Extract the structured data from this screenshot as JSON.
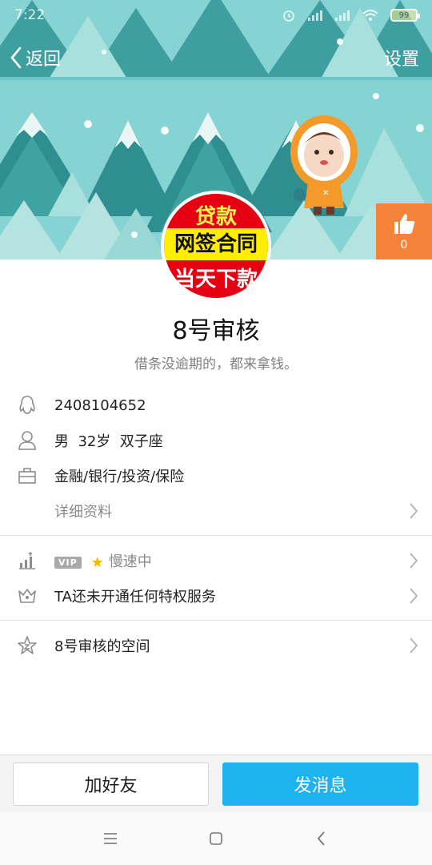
{
  "status_bar": {
    "time": "7:22",
    "battery": "99"
  },
  "nav": {
    "back_label": "返回",
    "settings_label": "设置"
  },
  "like": {
    "count": "0"
  },
  "avatar": {
    "line1": "贷款",
    "line2": "网签合同",
    "line3": "当天下款"
  },
  "profile": {
    "name": "8号审核",
    "signature": "借条没逾期的，都来拿钱。",
    "qq": "2408104652",
    "gender": "男",
    "age": "32岁",
    "zodiac": "双子座",
    "occupation": "金融/银行/投资/保险",
    "details_link": "详细资料"
  },
  "privileges": {
    "vip_badge": "VIP",
    "speed_text": "慢速中",
    "service_text": "TA还未开通任何特权服务"
  },
  "space": {
    "label": "8号审核的空间"
  },
  "buttons": {
    "add_friend": "加好友",
    "send_message": "发消息"
  },
  "colors": {
    "accent_blue": "#1fb2f0",
    "like_orange": "#f5843a",
    "banner_teal": "#7ecfd0"
  }
}
